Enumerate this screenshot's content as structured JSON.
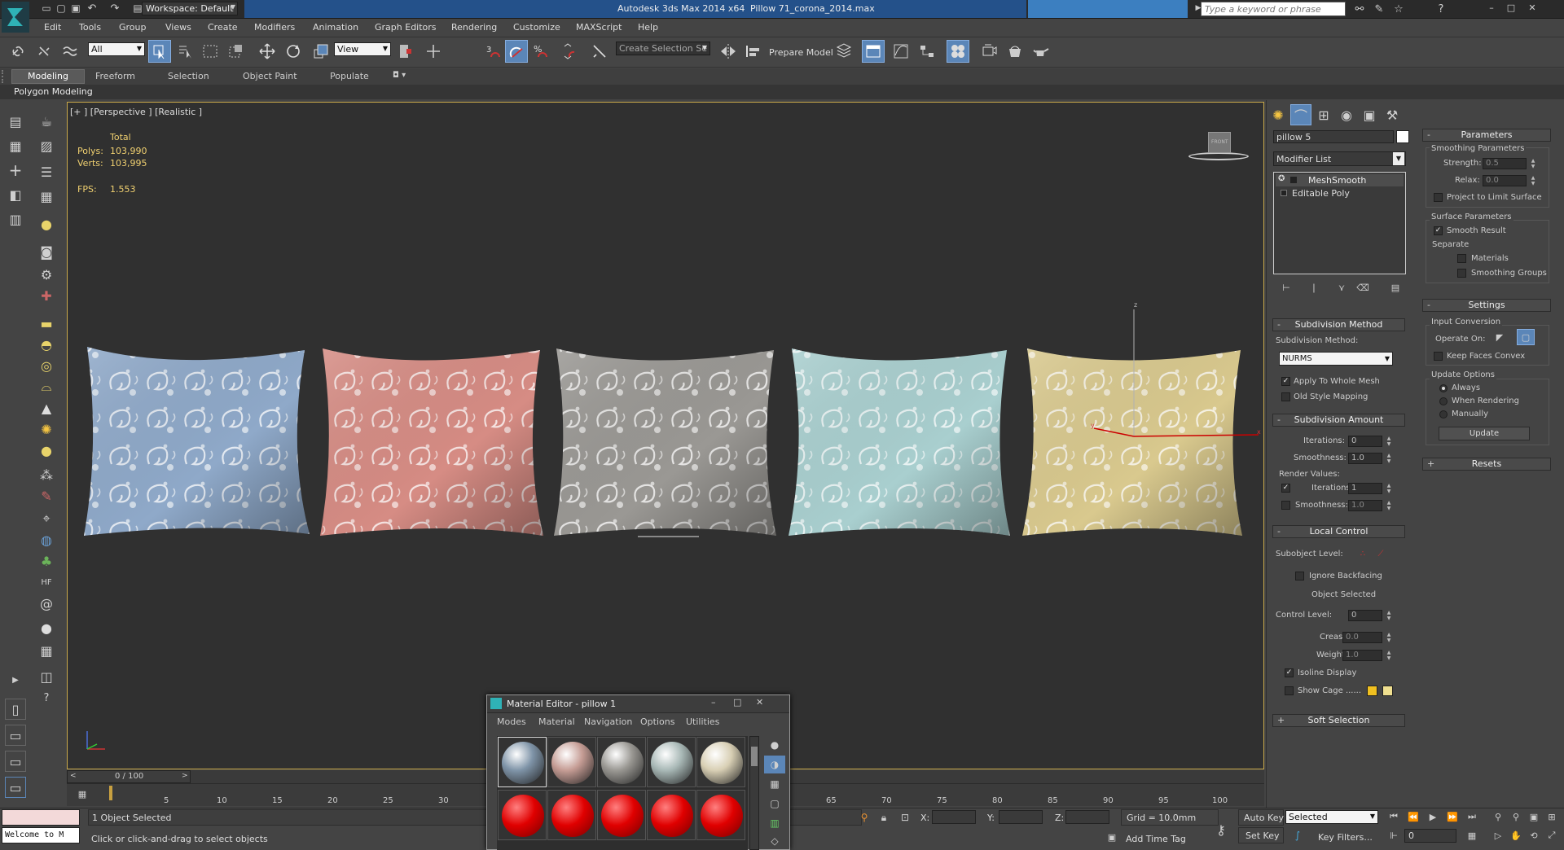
{
  "title_bar": {
    "workspace": "Workspace: Default",
    "app": "Autodesk 3ds Max  2014 x64",
    "file": "Pillow 71_corona_2014.max",
    "search_placeholder": "Type a keyword or phrase"
  },
  "menu": [
    "Edit",
    "Tools",
    "Group",
    "Views",
    "Create",
    "Modifiers",
    "Animation",
    "Graph Editors",
    "Rendering",
    "Customize",
    "MAXScript",
    "Help"
  ],
  "main_toolbar": {
    "filter_value": "All",
    "ref_coord_value": "View",
    "selection_set_placeholder": "Create Selection Se",
    "prepare_model": "Prepare Model"
  },
  "ribbon": {
    "tabs": [
      "Modeling",
      "Freeform",
      "Selection",
      "Object Paint",
      "Populate"
    ],
    "active_tab": "Modeling",
    "panel": "Polygon Modeling"
  },
  "viewport": {
    "label": "[+ ] [Perspective ] [Realistic ]",
    "stats": {
      "total_label": "Total",
      "polys_label": "Polys:",
      "polys": "103,990",
      "verts_label": "Verts:",
      "verts": "103,995",
      "fps_label": "FPS:",
      "fps": "1.553"
    },
    "viewcube_label": "FRONT",
    "gizmo_z": "z",
    "gizmo_x": "x",
    "gizmo_y": "y",
    "pillow_colors": [
      "#8fa9c9",
      "#d68c84",
      "#9a9894",
      "#a9cfcf",
      "#d9c98e"
    ]
  },
  "command_panel": {
    "object_name": "pillow 5",
    "modifier_list": "Modifier List",
    "stack": [
      "MeshSmooth",
      "Editable Poly"
    ],
    "subdivision_method": {
      "header": "Subdivision Method",
      "label": "Subdivision Method:",
      "value": "NURMS",
      "apply_whole": "Apply To Whole Mesh",
      "old_style": "Old Style Mapping"
    },
    "subdivision_amount": {
      "header": "Subdivision Amount",
      "iterations_label": "Iterations:",
      "iterations": "0",
      "smoothness_label": "Smoothness:",
      "smoothness": "1.0",
      "render_values": "Render Values:",
      "r_iterations_label": "Iterations:",
      "r_iterations": "1",
      "r_smoothness_label": "Smoothness:",
      "r_smoothness": "1.0"
    },
    "local_control": {
      "header": "Local Control",
      "subobject_level": "Subobject Level:",
      "ignore_backfacing": "Ignore Backfacing",
      "object_selected": "Object Selected",
      "control_level_label": "Control Level:",
      "control_level": "0",
      "crease_label": "Crease:",
      "crease": "0.0",
      "weight_label": "Weight:",
      "weight": "1.0",
      "isoline": "Isoline Display",
      "show_cage": "Show Cage ......"
    },
    "soft_selection": "Soft Selection"
  },
  "params_panel": {
    "header": "Parameters",
    "smoothing_group": "Smoothing Parameters",
    "strength_label": "Strength:",
    "strength": "0.5",
    "relax_label": "Relax:",
    "relax": "0.0",
    "project_limit": "Project to Limit Surface",
    "surface_group": "Surface Parameters",
    "smooth_result": "Smooth Result",
    "separate": "Separate",
    "materials": "Materials",
    "smoothing_groups": "Smoothing Groups",
    "settings_header": "Settings",
    "input_conversion": "Input Conversion",
    "operate_on": "Operate On:",
    "keep_faces": "Keep Faces Convex",
    "update_options": "Update Options",
    "always": "Always",
    "when_rendering": "When Rendering",
    "manually": "Manually",
    "update_btn": "Update",
    "resets_header": "Resets"
  },
  "material_editor": {
    "title": "Material Editor - pillow 1",
    "menus": [
      "Modes",
      "Material",
      "Navigation",
      "Options",
      "Utilities"
    ],
    "sphere_colors": [
      "#7f94a8",
      "#c59c94",
      "#9a9893",
      "#a8b8b6",
      "#d8cfb4"
    ]
  },
  "timeline": {
    "frame": "0 / 100",
    "ticks": [
      "5",
      "10",
      "15",
      "20",
      "25",
      "30",
      "65",
      "70",
      "75",
      "80",
      "85",
      "90",
      "95",
      "100"
    ]
  },
  "status": {
    "maxscript": "Welcome to M",
    "selected": "1 Object Selected",
    "prompt": "Click or click-and-drag to select objects",
    "x_label": "X:",
    "y_label": "Y:",
    "z_label": "Z:",
    "grid": "Grid = 10.0mm",
    "add_time_tag": "Add Time Tag",
    "auto_key": "Auto Key",
    "set_key": "Set Key",
    "selected_dropdown": "Selected",
    "key_filters": "Key Filters...",
    "frame_value": "0"
  }
}
